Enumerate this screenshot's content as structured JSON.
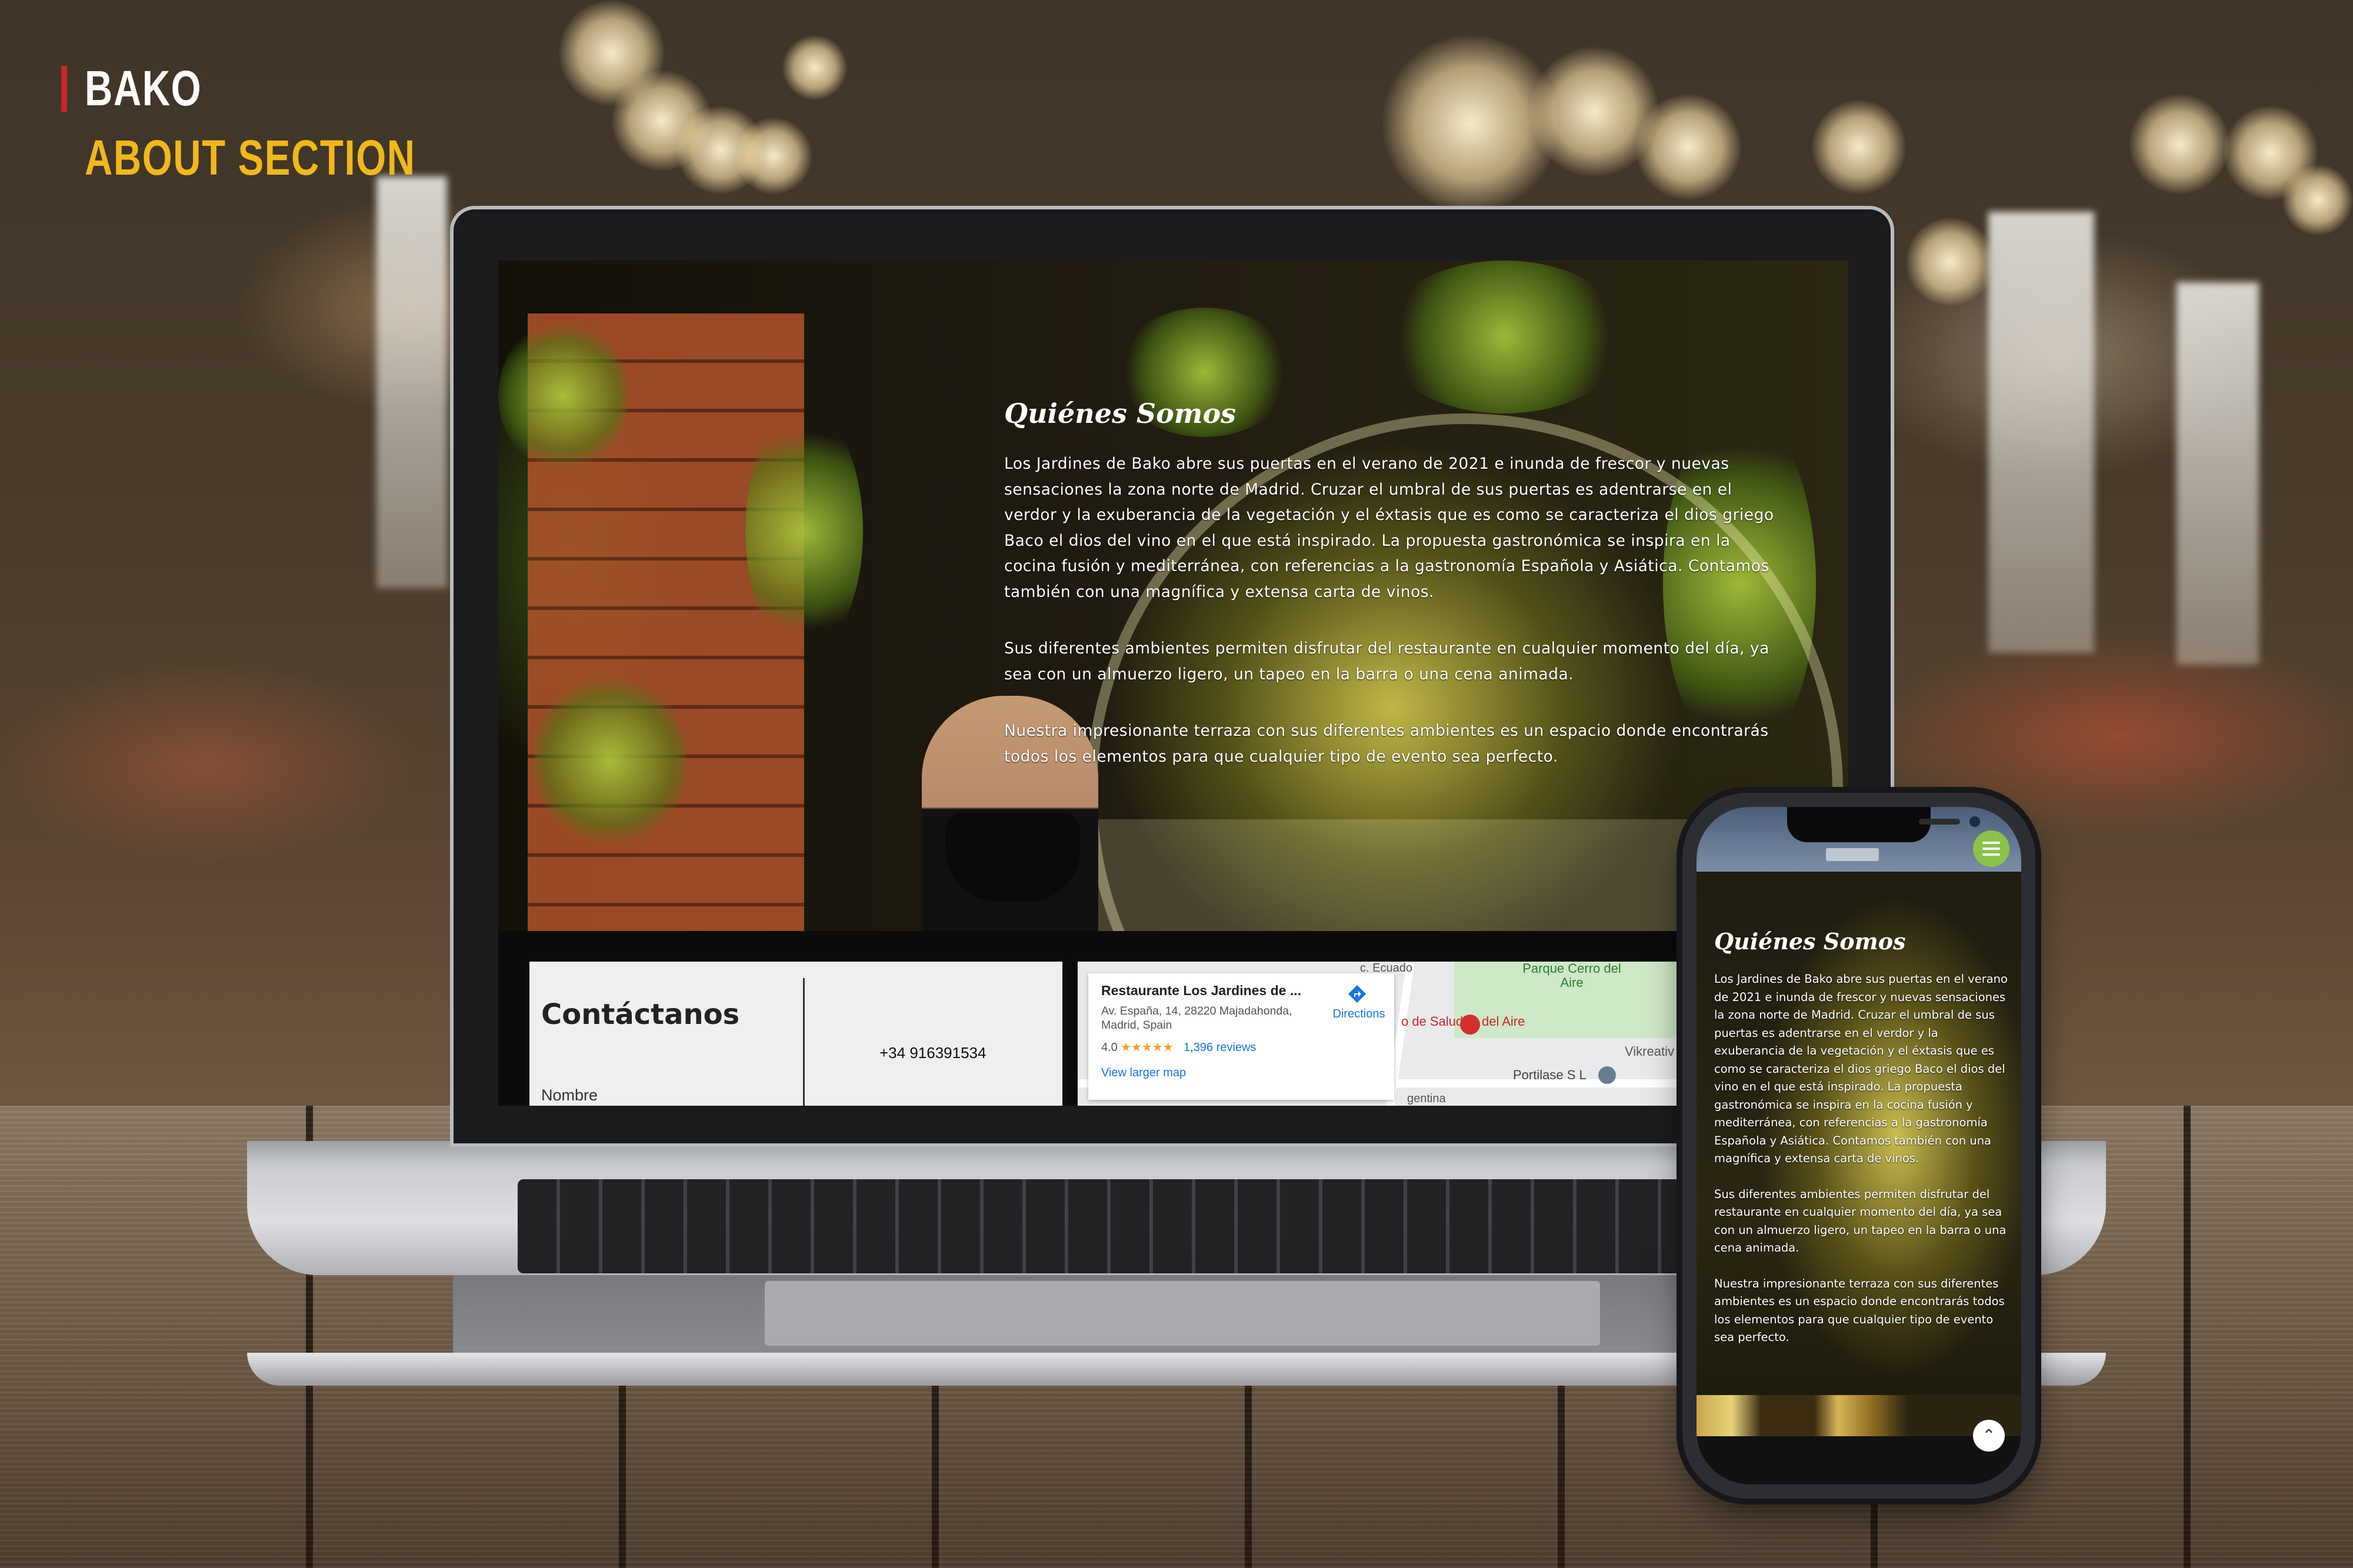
{
  "mockup": {
    "brand": "BAKO",
    "section": "ABOUT SECTION",
    "accent_bar_color": "#c62828",
    "section_color": "#f0b81a"
  },
  "desktop": {
    "about": {
      "title": "Quiénes Somos",
      "paragraphs": [
        "Los Jardines de Bako abre sus puertas en el verano de 2021 e inunda de frescor y nuevas sensaciones la zona norte de Madrid. Cruzar el umbral de sus puertas es adentrarse en el verdor y la exuberancia de la vegetación y el éxtasis que es como se caracteriza el dios griego Baco el dios del vino en el que está inspirado. La propuesta gastronómica se inspira en la cocina fusión y mediterránea, con referencias a la gastronomía Española y Asiática. Contamos también con una magnífica y extensa carta de vinos.",
        "Sus diferentes ambientes permiten disfrutar del restaurante en cualquier momento del día, ya sea con un almuerzo ligero, un tapeo en la barra o una cena animada.",
        "Nuestra impresionante terraza con sus diferentes ambientes es un espacio donde encontrarás todos los elementos para que cualquier tipo de evento sea perfecto."
      ]
    },
    "contact": {
      "title": "Contáctanos",
      "phone": "+34 916391534",
      "name_label": "Nombre"
    },
    "map": {
      "place_name": "Restaurante Los Jardines de ...",
      "address": "Av. España, 14, 28220 Majadahonda, Madrid, Spain",
      "rating": "4.0",
      "stars": "★★★★★",
      "reviews": "1,396 reviews",
      "larger_map": "View larger map",
      "directions": "Directions",
      "labels": {
        "ecuador": "c. Ecuado",
        "park": "Parque Cerro del Aire",
        "salud": "o de Salud ro del Aire",
        "vikreativ": "Vikreativ",
        "portilase": "Portilase S L",
        "argentina": "gentina"
      }
    }
  },
  "mobile": {
    "about": {
      "title": "Quiénes Somos",
      "paragraphs": [
        "Los Jardines de Bako abre sus puertas en el verano de 2021 e inunda de frescor y nuevas sensaciones la zona norte de Madrid. Cruzar el umbral de sus puertas es adentrarse en el verdor y la exuberancia de la vegetación y el éxtasis que es como se caracteriza el dios griego Baco el dios del vino en el que está inspirado. La propuesta gastronómica se inspira en la cocina fusión y mediterránea, con referencias a la gastronomía Española y Asiática. Contamos también con una magnífica y extensa carta de vinos.",
        "Sus diferentes ambientes permiten disfrutar del restaurante en cualquier momento del día, ya sea con un almuerzo ligero, un tapeo en la barra o una cena animada.",
        "Nuestra impresionante terraza con sus diferentes ambientes es un espacio donde encontrarás todos los elementos para que cualquier tipo de evento sea perfecto."
      ]
    },
    "menu_icon": "hamburger-icon",
    "scroll_top_icon": "chevron-up-icon",
    "scroll_top_glyph": "⌃",
    "menu_button_color": "#8bc34a"
  }
}
